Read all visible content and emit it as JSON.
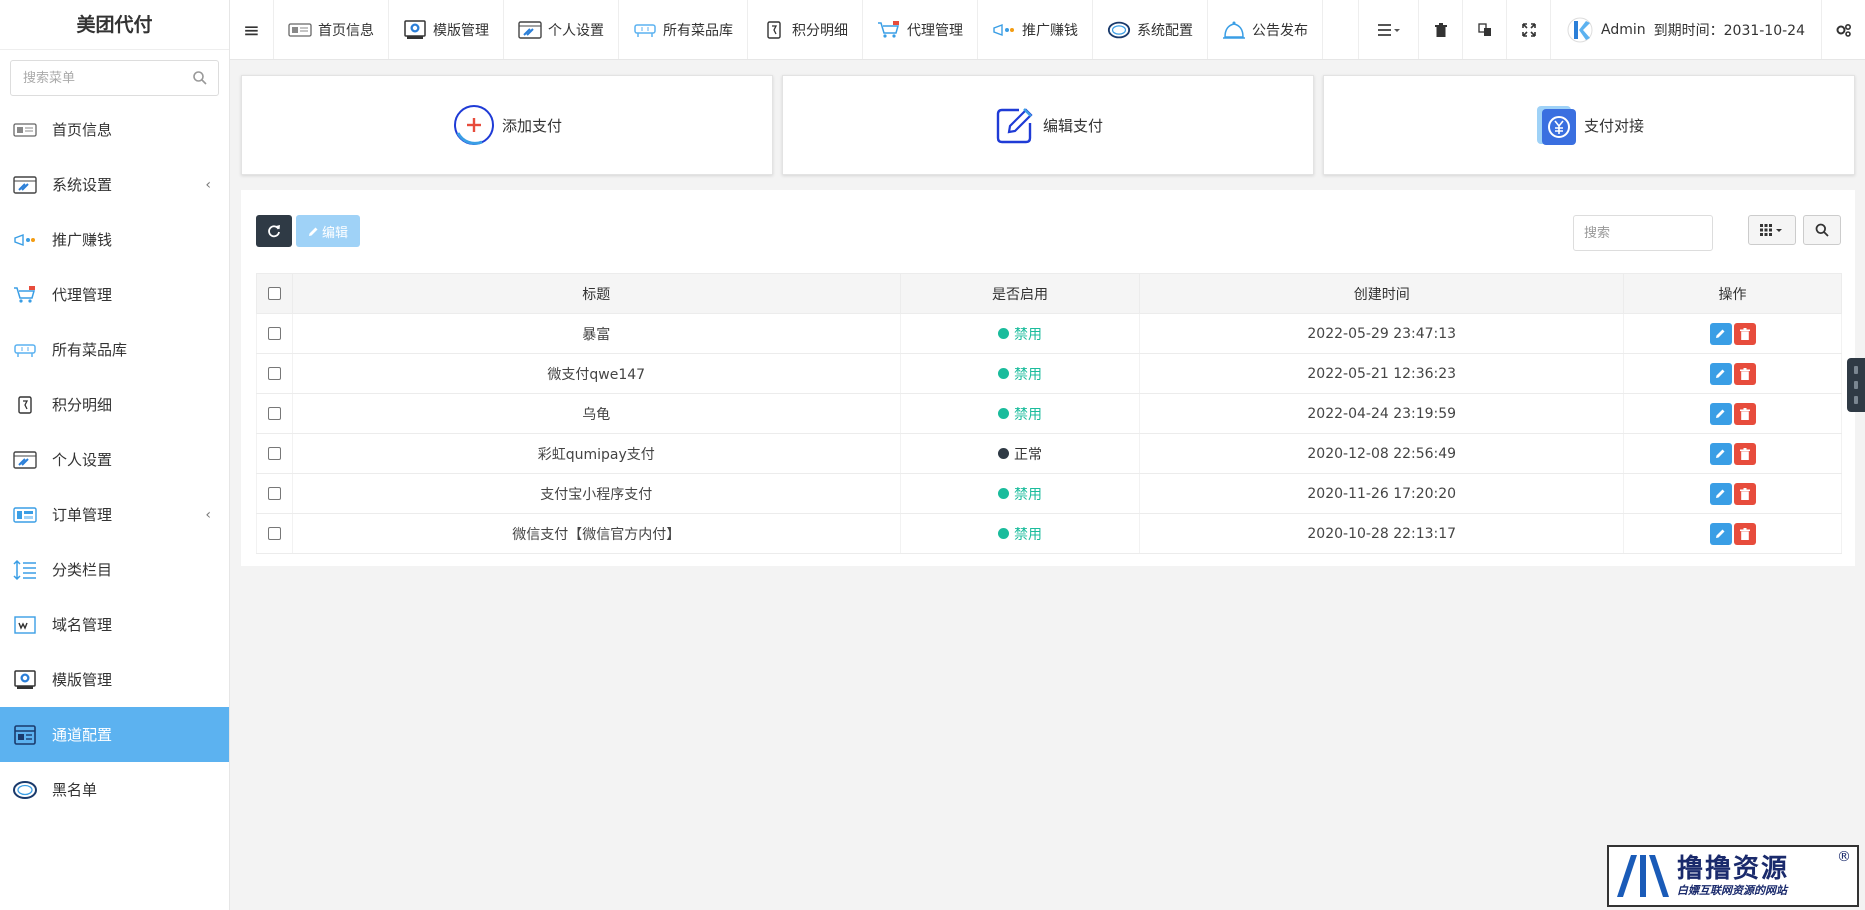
{
  "app": {
    "title": "美团代付"
  },
  "sidebar": {
    "search_placeholder": "搜索菜单",
    "items": [
      {
        "label": "首页信息",
        "icon": "homepage-icon"
      },
      {
        "label": "系统设置",
        "icon": "system-settings-icon",
        "expandable": true
      },
      {
        "label": "推广赚钱",
        "icon": "promotion-icon"
      },
      {
        "label": "代理管理",
        "icon": "agent-cart-icon"
      },
      {
        "label": "所有菜品库",
        "icon": "dishes-icon"
      },
      {
        "label": "积分明细",
        "icon": "points-icon"
      },
      {
        "label": "个人设置",
        "icon": "personal-settings-icon"
      },
      {
        "label": "订单管理",
        "icon": "orders-icon",
        "expandable": true
      },
      {
        "label": "分类栏目",
        "icon": "category-icon"
      },
      {
        "label": "域名管理",
        "icon": "domain-icon"
      },
      {
        "label": "模版管理",
        "icon": "template-icon"
      },
      {
        "label": "通道配置",
        "icon": "channel-config-icon",
        "active": true
      },
      {
        "label": "黑名单",
        "icon": "blacklist-icon"
      }
    ],
    "chevron": "‹"
  },
  "topbar": {
    "menu_toggle": "≡",
    "tabs": [
      {
        "label": "首页信息",
        "icon": "homepage-icon"
      },
      {
        "label": "模版管理",
        "icon": "template-icon"
      },
      {
        "label": "个人设置",
        "icon": "personal-settings-icon"
      },
      {
        "label": "所有菜品库",
        "icon": "dishes-icon"
      },
      {
        "label": "积分明细",
        "icon": "points-icon"
      },
      {
        "label": "代理管理",
        "icon": "agent-cart-icon"
      },
      {
        "label": "推广赚钱",
        "icon": "promotion-icon"
      },
      {
        "label": "系统配置",
        "icon": "system-config-icon"
      },
      {
        "label": "公告发布",
        "icon": "announcement-icon"
      }
    ],
    "user_name": "Admin",
    "expire_label": "到期时间：2031-10-24"
  },
  "cards": [
    {
      "label": "添加支付",
      "icon": "add-circle-icon"
    },
    {
      "label": "编辑支付",
      "icon": "edit-square-icon"
    },
    {
      "label": "支付对接",
      "icon": "payment-yuan-icon"
    }
  ],
  "toolbar": {
    "edit_label": "编辑",
    "search_placeholder": "搜索"
  },
  "table": {
    "columns": [
      "标题",
      "是否启用",
      "创建时间",
      "操作"
    ],
    "rows": [
      {
        "title": "暴富",
        "status": "禁用",
        "status_color": "#1abc9c",
        "created": "2022-05-29 23:47:13"
      },
      {
        "title": "微支付qwe147",
        "status": "禁用",
        "status_color": "#1abc9c",
        "created": "2022-05-21 12:36:23"
      },
      {
        "title": "乌龟",
        "status": "禁用",
        "status_color": "#1abc9c",
        "created": "2022-04-24 23:19:59"
      },
      {
        "title": "彩虹qumipay支付",
        "status": "正常",
        "status_color": "#2f3a45",
        "created": "2020-12-08 22:56:49"
      },
      {
        "title": "支付宝小程序支付",
        "status": "禁用",
        "status_color": "#1abc9c",
        "created": "2020-11-26 17:20:20"
      },
      {
        "title": "微信支付【微信官方内付】",
        "status": "禁用",
        "status_color": "#1abc9c",
        "created": "2020-10-28 22:13:17"
      }
    ]
  },
  "watermark": {
    "main": "撸撸资源",
    "sub": "白嫖互联网资源的网站",
    "reg": "®"
  },
  "colors": {
    "active_menu": "#5cb2f0",
    "enabled_green": "#1abc9c",
    "edit_blue": "#3a9ee5",
    "delete_red": "#e74c3c"
  }
}
